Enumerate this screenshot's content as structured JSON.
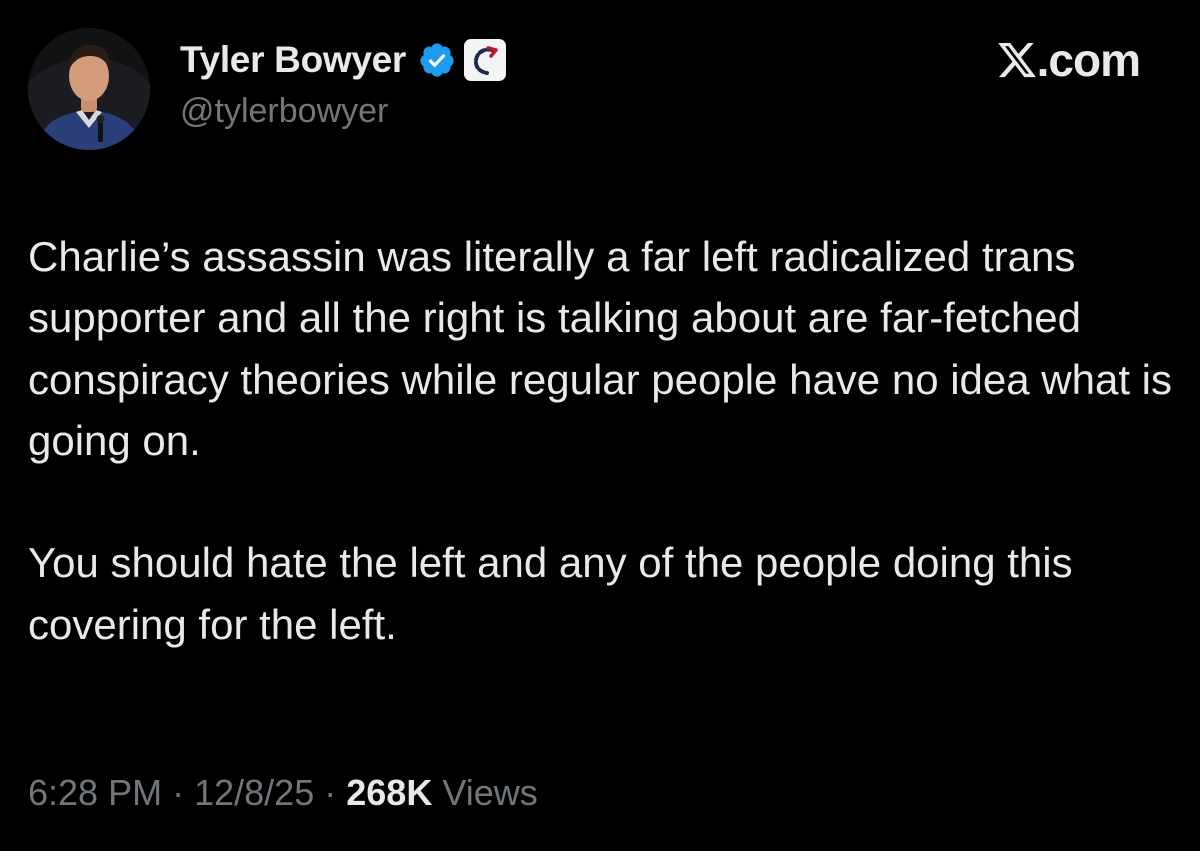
{
  "author": {
    "name": "Tyler Bowyer",
    "handle": "@tylerbowyer",
    "verified": true,
    "badge_color": "#1d9bf0"
  },
  "site": {
    "name": ".com",
    "icon": "x-logo-icon"
  },
  "post": {
    "paragraphs": [
      "Charlie’s assassin was literally a far left radicalized trans supporter and all the right is talking about are far-fetched conspiracy theories while regular people have no idea what is going on.",
      "You should hate the left and any of the people doing this covering for the left."
    ]
  },
  "meta": {
    "time": "6:28 PM",
    "separator": "·",
    "date": "12/8/25",
    "views_count": "268K",
    "views_label": "Views"
  },
  "colors": {
    "background": "#000000",
    "text": "#e7e9ea",
    "secondary_text": "#71767b",
    "verified": "#1d9bf0"
  }
}
